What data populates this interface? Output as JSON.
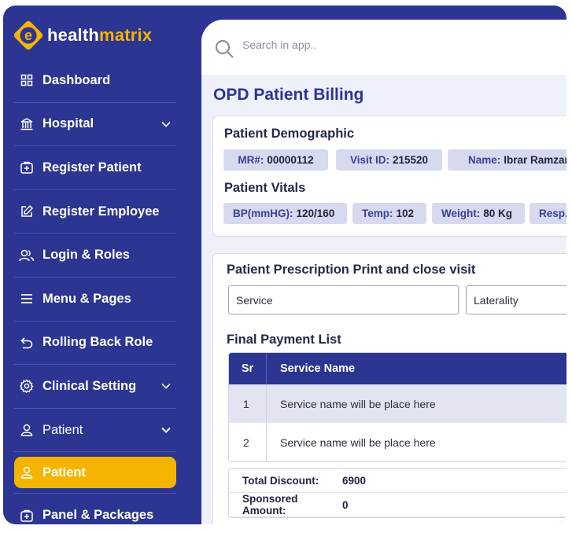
{
  "brand": {
    "letter": "e",
    "name_part1": "health",
    "name_part2": "matrix"
  },
  "sidebar": {
    "items": [
      {
        "label": "Dashboard",
        "icon": "grid-icon"
      },
      {
        "label": "Hospital",
        "icon": "hospital-icon",
        "expandable": true
      },
      {
        "label": "Register Patient",
        "icon": "add-box-icon"
      },
      {
        "label": "Register Employee",
        "icon": "edit-icon"
      },
      {
        "label": "Login & Roles",
        "icon": "users-icon"
      },
      {
        "label": "Menu & Pages",
        "icon": "menu-icon"
      },
      {
        "label": "Rolling Back Role",
        "icon": "undo-icon"
      },
      {
        "label": "Clinical Setting",
        "icon": "gear-icon",
        "expandable": true
      },
      {
        "label": "Patient",
        "icon": "user-icon",
        "expandable": true
      },
      {
        "label": "Patient",
        "icon": "user-icon",
        "active": true
      },
      {
        "label": "Panel & Packages",
        "icon": "add-box-icon"
      }
    ]
  },
  "search": {
    "placeholder": "Search in app.."
  },
  "page": {
    "title": "OPD Patient Billing"
  },
  "demographic": {
    "title": "Patient Demographic",
    "mr_label": "MR#:",
    "mr_value": "00000112",
    "visit_label": "Visit ID:",
    "visit_value": "215520",
    "name_label": "Name:",
    "name_value": "Ibrar Ramzan"
  },
  "vitals": {
    "title": "Patient Vitals",
    "bp_label": "BP(mmHG):",
    "bp_value": "120/160",
    "temp_label": "Temp:",
    "temp_value": "102",
    "weight_label": "Weight:",
    "weight_value": "80 Kg",
    "resp_label": "Resp.",
    "resp_value": ""
  },
  "prescription": {
    "title": "Patient Prescription Print and close visit",
    "service_value": "Service",
    "laterality_value": "Laterality"
  },
  "payment": {
    "title": "Final Payment List",
    "columns": [
      "Sr",
      "Service Name"
    ],
    "rows": [
      {
        "sr": "1",
        "name": "Service name will be place here"
      },
      {
        "sr": "2",
        "name": "Service name will be place here"
      }
    ],
    "total_discount_label": "Total Discount:",
    "total_discount_value": "6900",
    "sponsored_label": "Sponsored Amount:",
    "sponsored_value": "0"
  },
  "colors": {
    "primary": "#2c3592",
    "accent": "#f5b400",
    "chip": "#d7d9ee"
  }
}
